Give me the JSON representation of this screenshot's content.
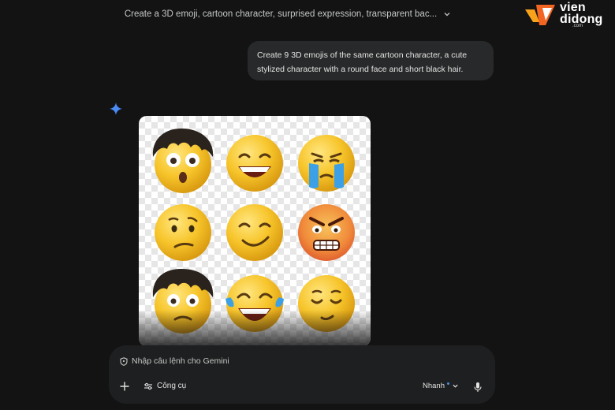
{
  "header": {
    "conversation_title": "Create a 3D emoji, cartoon character, surprised expression, transparent bac...",
    "title_icon": "chevron-down-icon"
  },
  "logo": {
    "line1": "vien",
    "line2": "didong",
    "suffix": ".com",
    "brand_colors": [
      "#f7a21b",
      "#f26522"
    ]
  },
  "chat": {
    "user_message": "Create 9 3D emojis of the same cartoon character, a cute stylized character with a round face and short black hair.",
    "assistant_icon": "sparkle-icon",
    "assistant_icon_color": "#4a8cf7",
    "generated_image": {
      "grid": [
        [
          "surprised-with-hair",
          "grinning",
          "crying"
        ],
        [
          "confused",
          "smiling",
          "angry"
        ],
        [
          "worried-with-hair",
          "tears-of-joy",
          "relieved"
        ]
      ]
    }
  },
  "input": {
    "placeholder": "Nhập câu lệnh cho Gemini",
    "placeholder_icon": "shield-icon",
    "add_icon": "plus-icon",
    "tools_label": "Công cụ",
    "tools_icon": "sliders-icon",
    "mode_label": "Nhanh",
    "mode_icon": "chevron-down-icon",
    "mic_icon": "mic-icon"
  },
  "colors": {
    "background": "#131314",
    "bubble": "#28292a",
    "input": "#1e1f20",
    "emoji_yellow": "#f7c52b"
  }
}
